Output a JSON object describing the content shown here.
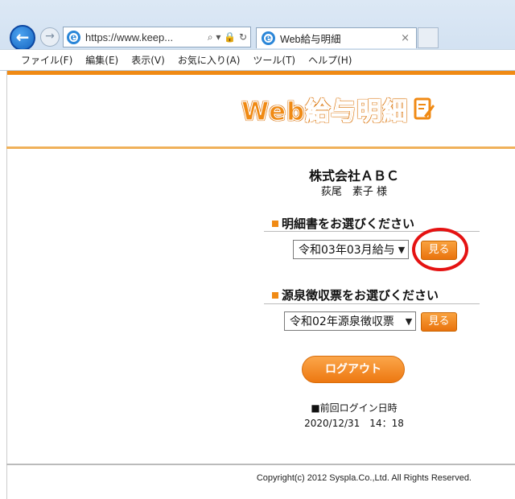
{
  "browser": {
    "address_url": "https://www.keep...",
    "tab_title": "Web給与明細",
    "menu": [
      "ファイル(F)",
      "編集(E)",
      "表示(V)",
      "お気に入り(A)",
      "ツール(T)",
      "ヘルプ(H)"
    ],
    "tab_close": "×",
    "back_glyph": "←",
    "forward_glyph": "→",
    "address_icons": "⌕ ▾ 🔒 ↻"
  },
  "page": {
    "logo_text": "Web給与明細",
    "company": "株式会社ＡＢＣ",
    "user": "荻尾　素子 様",
    "payslip": {
      "title": "明細書をお選びください",
      "selected": "令和03年03月給与",
      "view_label": "見る"
    },
    "withholding": {
      "title": "源泉徴収票をお選びください",
      "selected": "令和02年源泉徴収票",
      "view_label": "見る"
    },
    "logout_label": "ログアウト",
    "last_login_label": "■前回ログイン日時",
    "last_login_value": "2020/12/31　14：18",
    "copyright": "Copyright(c) 2012 Syspla.Co.,Ltd. All Rights Reserved."
  },
  "colors": {
    "accent": "#f08a14",
    "highlight_circle": "#e51212"
  }
}
